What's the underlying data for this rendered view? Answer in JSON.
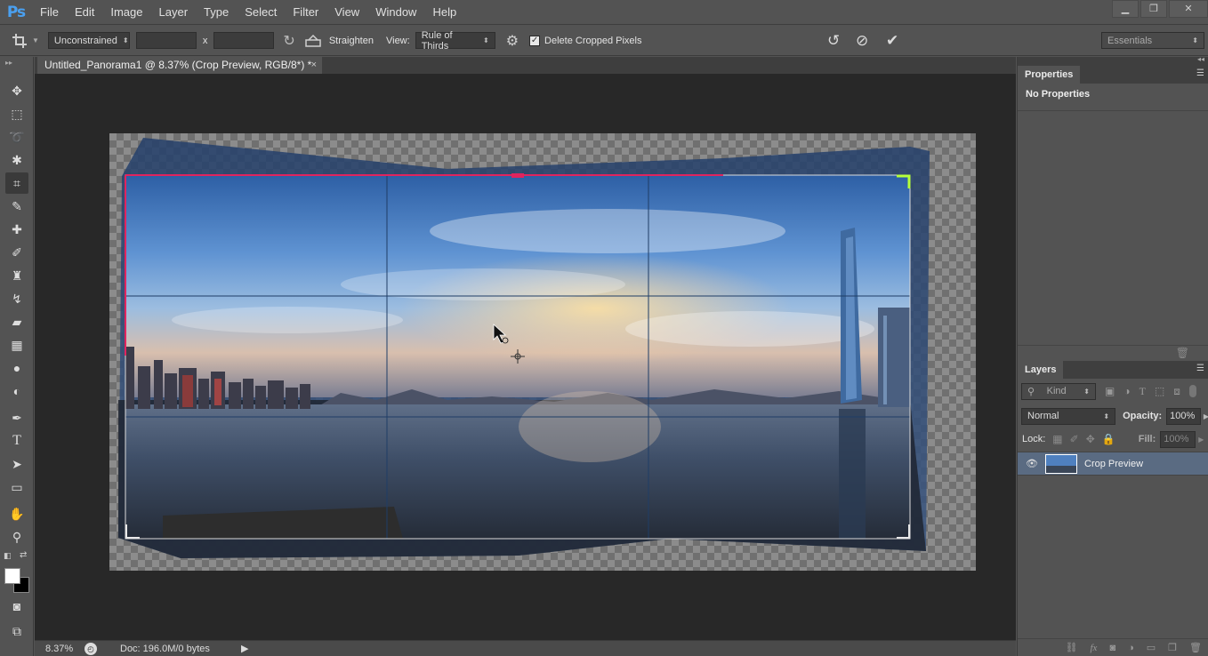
{
  "menu": {
    "logo": "Ps",
    "items": [
      "File",
      "Edit",
      "Image",
      "Layer",
      "Type",
      "Select",
      "Filter",
      "View",
      "Window",
      "Help"
    ]
  },
  "window_controls": {
    "minimize": "▁",
    "restore": "❐",
    "close": "✕"
  },
  "options": {
    "ratio_value": "Unconstrained",
    "times_label": "x",
    "straighten_label": "Straighten",
    "view_label": "View:",
    "view_value": "Rule of Thirds",
    "delete_cropped_label": "Delete Cropped Pixels",
    "delete_cropped_checked": true,
    "workspace_value": "Essentials"
  },
  "document": {
    "tab_title": "Untitled_Panorama1 @ 8.37% (Crop Preview, RGB/8*) *",
    "close_glyph": "×"
  },
  "status": {
    "zoom": "8.37%",
    "doc_info": "Doc: 196.0M/0 bytes"
  },
  "properties": {
    "tab": "Properties",
    "content": "No Properties"
  },
  "layers": {
    "tab": "Layers",
    "filter_kind": "Kind",
    "blend_mode": "Normal",
    "opacity_label": "Opacity:",
    "opacity_value": "100%",
    "lock_label": "Lock:",
    "fill_label": "Fill:",
    "fill_value": "100%",
    "items": [
      {
        "name": "Crop Preview",
        "visible": true,
        "selected": true
      }
    ]
  },
  "colors": {
    "accent_blue": "#4aa0f0",
    "crop_edge_magenta": "#e0245e",
    "crop_corner_green": "#b6ff3a",
    "selected_layer": "#5a6b82"
  }
}
